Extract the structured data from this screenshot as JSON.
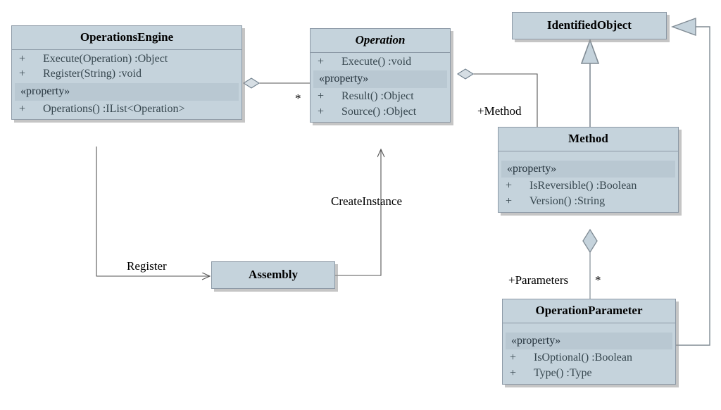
{
  "diagram": {
    "type": "uml-class-diagram",
    "background": "#ffffff",
    "box_fill": "#c5d3dc",
    "box_border": "#8c99a6",
    "stereotype_fill": "#b9c8d2",
    "line_color": "#555555"
  },
  "classes": {
    "operations_engine": {
      "name": "OperationsEngine",
      "abstract": false,
      "operations": [
        {
          "visibility": "+",
          "signature": "Execute(Operation)  :Object"
        },
        {
          "visibility": "+",
          "signature": "Register(String)  :void"
        }
      ],
      "stereotype": "«property»",
      "properties": [
        {
          "visibility": "+",
          "signature": "Operations()  :IList<Operation>"
        }
      ]
    },
    "operation": {
      "name": "Operation",
      "abstract": true,
      "operations": [
        {
          "visibility": "+",
          "signature": "Execute()  :void"
        }
      ],
      "stereotype": "«property»",
      "properties": [
        {
          "visibility": "+",
          "signature": "Result()  :Object"
        },
        {
          "visibility": "+",
          "signature": "Source()  :Object"
        }
      ]
    },
    "identified_object": {
      "name": "IdentifiedObject",
      "abstract": false
    },
    "method": {
      "name": "Method",
      "abstract": false,
      "stereotype": "«property»",
      "properties": [
        {
          "visibility": "+",
          "signature": "IsReversible()  :Boolean"
        },
        {
          "visibility": "+",
          "signature": "Version()  :String"
        }
      ]
    },
    "operation_parameter": {
      "name": "OperationParameter",
      "abstract": false,
      "stereotype": "«property»",
      "properties": [
        {
          "visibility": "+",
          "signature": "IsOptional()  :Boolean"
        },
        {
          "visibility": "+",
          "signature": "Type()  :Type"
        }
      ]
    },
    "assembly": {
      "name": "Assembly",
      "abstract": false
    }
  },
  "relations": {
    "engine_operation": {
      "kind": "aggregation",
      "source": "OperationsEngine",
      "target": "Operation",
      "target_multiplicity": "*"
    },
    "operation_method": {
      "kind": "aggregation",
      "source": "Operation",
      "target": "Method",
      "role": "+Method"
    },
    "method_identified": {
      "kind": "generalization",
      "source": "Method",
      "target": "IdentifiedObject"
    },
    "parameter_identified": {
      "kind": "generalization",
      "source": "OperationParameter",
      "target": "IdentifiedObject"
    },
    "method_parameters": {
      "kind": "aggregation",
      "source": "Method",
      "target": "OperationParameter",
      "role": "+Parameters",
      "target_multiplicity": "*"
    },
    "engine_assembly": {
      "kind": "dependency",
      "source": "OperationsEngine",
      "target": "Assembly",
      "label": "Register"
    },
    "assembly_operation": {
      "kind": "dependency",
      "source": "Assembly",
      "target": "Operation",
      "label": "CreateInstance"
    }
  }
}
